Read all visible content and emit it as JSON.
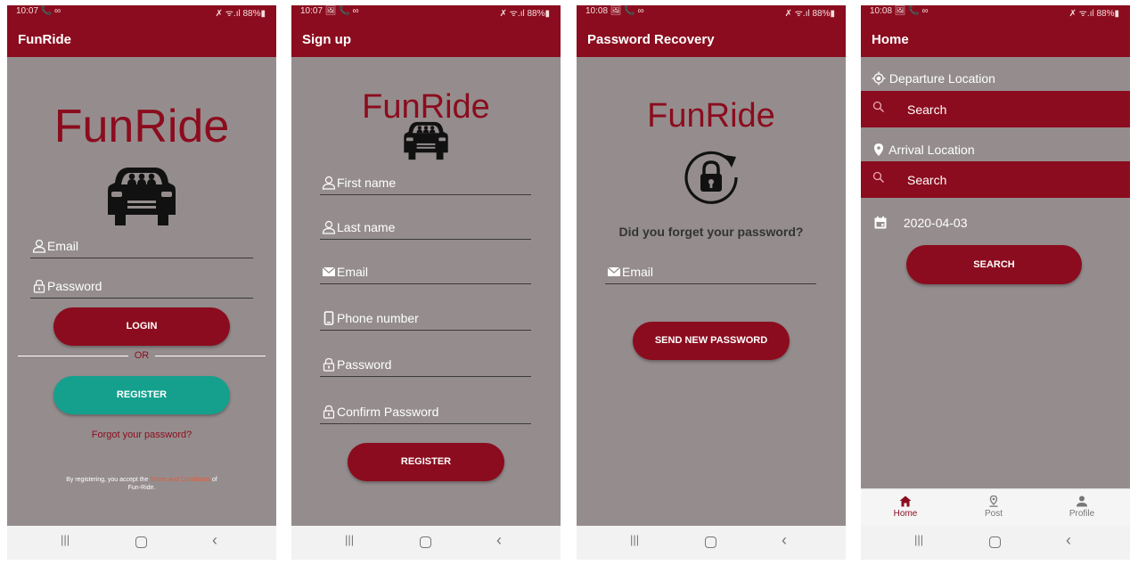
{
  "colors": {
    "primary": "#8b0c1e",
    "teal": "#14a08d",
    "background": "#958d8d",
    "link": "#e35b3b"
  },
  "phones": [
    {
      "status": {
        "time": "10:07 📞 ∞",
        "right": "✗ ᯤ.ıl 88%▮"
      },
      "appbar": "FunRide",
      "logo": "FunRide",
      "email_placeholder": "Email",
      "password_placeholder": "Password",
      "login_label": "LOGIN",
      "or_label": "OR",
      "register_label": "REGISTER",
      "forgot_label": "Forgot your password?",
      "terms": {
        "prefix": "By registering, you accept the ",
        "link": "Terms and Conditions",
        "suffix": " of",
        "line2": "Fun-Ride."
      }
    },
    {
      "status": {
        "time": "10:07 🖼 📞 ∞",
        "right": "✗ ᯤ.ıl 88%▮"
      },
      "appbar": "Sign up",
      "logo": "FunRide",
      "first_name": "First name",
      "last_name": "Last name",
      "email": "Email",
      "phone": "Phone number",
      "password": "Password",
      "confirm_password": "Confirm Password",
      "register_label": "REGISTER"
    },
    {
      "status": {
        "time": "10:08 🖼 📞 ∞",
        "right": "✗ ᯤ.ıl 88%▮"
      },
      "appbar": "Password Recovery",
      "logo": "FunRide",
      "question": "Did you forget your password?",
      "email": "Email",
      "send_label": "SEND NEW PASSWORD"
    },
    {
      "status": {
        "time": "10:08 🖼 📞 ∞",
        "right": "✗ ᯤ.ıl 88%▮"
      },
      "appbar": "Home",
      "departure_label": "Departure Location",
      "departure_search": "Search",
      "arrival_label": "Arrival Location",
      "arrival_search": "Search",
      "date": "2020-04-03",
      "search_button": "SEARCH",
      "tabs": [
        {
          "label": "Home"
        },
        {
          "label": "Post"
        },
        {
          "label": "Profile"
        }
      ]
    }
  ],
  "navbar": {
    "recents": "|||",
    "back": "‹"
  }
}
